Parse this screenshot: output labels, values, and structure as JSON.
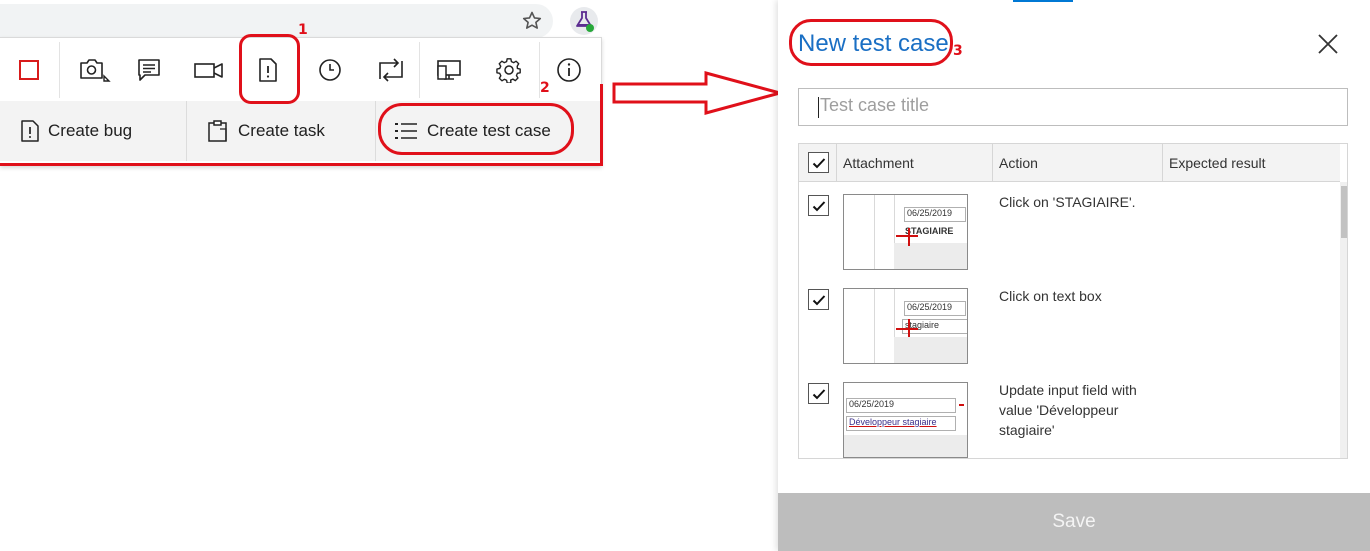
{
  "popup_menu": {
    "create_bug": "Create bug",
    "create_task": "Create task",
    "create_test_case": "Create test case"
  },
  "annotations": {
    "step1": "1",
    "step2": "2",
    "step3": "3"
  },
  "dialog": {
    "title": "New test case",
    "title_placeholder": "Test case title",
    "save_label": "Save",
    "columns": {
      "attachment": "Attachment",
      "action": "Action",
      "expected": "Expected result"
    },
    "steps": [
      {
        "action": "Click on 'STAGIAIRE'.",
        "checked": true,
        "thumb_date": "06/25/2019",
        "thumb_text": "STAGIAIRE"
      },
      {
        "action": "Click on text box",
        "checked": true,
        "thumb_date": "06/25/2019",
        "thumb_text": "stagiaire"
      },
      {
        "action": "Update input field with value 'Développeur stagiaire'",
        "checked": true,
        "thumb_date": "06/25/2019",
        "thumb_text": "Développeur stagiaire"
      }
    ]
  },
  "colors": {
    "annotation_red": "#e0101a",
    "title_blue": "#1a6fc4",
    "save_disabled": "#bdbdbd",
    "stop_red": "#d81b1b"
  },
  "icons": [
    "star-icon",
    "flask-icon",
    "stop-icon",
    "screenshot-icon",
    "note-icon",
    "video-icon",
    "exploration-item-icon",
    "timeline-icon",
    "capture-icon",
    "device-icon",
    "settings-icon",
    "info-icon",
    "bug-icon",
    "task-icon",
    "test-case-icon",
    "close-icon",
    "check-icon"
  ]
}
